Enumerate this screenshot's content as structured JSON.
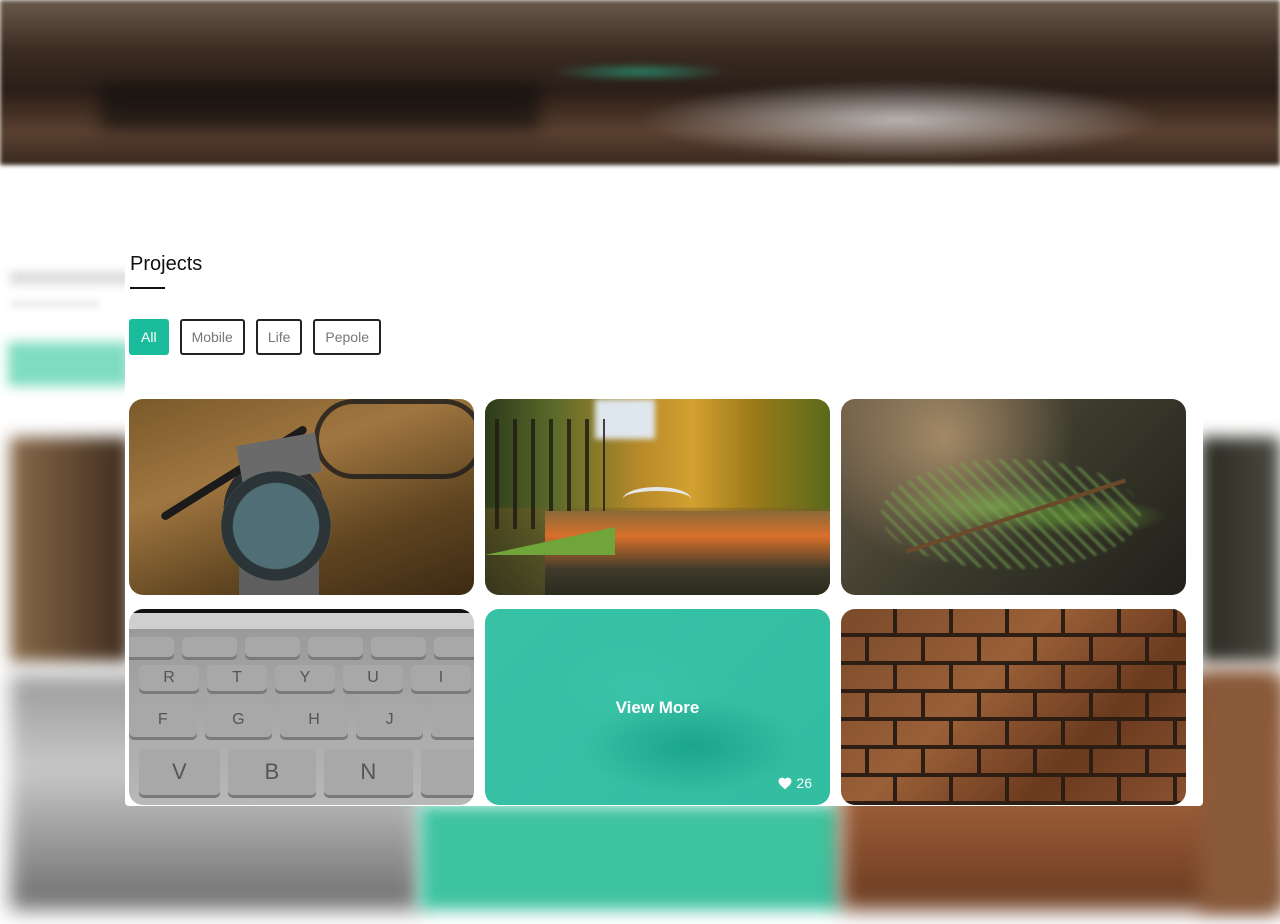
{
  "projects": {
    "title": "Projects",
    "filters": [
      {
        "label": "All",
        "active": true
      },
      {
        "label": "Mobile",
        "active": false
      },
      {
        "label": "Life",
        "active": false
      },
      {
        "label": "Pepole",
        "active": false
      }
    ],
    "items": [
      {
        "image": "wristwatch-on-wood-photo"
      },
      {
        "image": "autumn-park-canal-bridge-photo"
      },
      {
        "image": "fir-branch-bokeh-photo"
      },
      {
        "image": "laptop-keyboard-photo"
      },
      {
        "image": "woman-lying-photo",
        "hover_label": "View More",
        "likes": "26",
        "like_icon": "heart-icon"
      },
      {
        "image": "brick-wall-photo"
      }
    ],
    "keyboard_keys": {
      "row1": [
        "R",
        "T",
        "Y",
        "U",
        "I"
      ],
      "row2": [
        "F",
        "G",
        "H",
        "J"
      ],
      "row3": [
        "V",
        "B",
        "N"
      ]
    }
  },
  "colors": {
    "accent": "#1abc9c",
    "border": "#222222",
    "text": "#111111",
    "muted_text": "#777777"
  }
}
